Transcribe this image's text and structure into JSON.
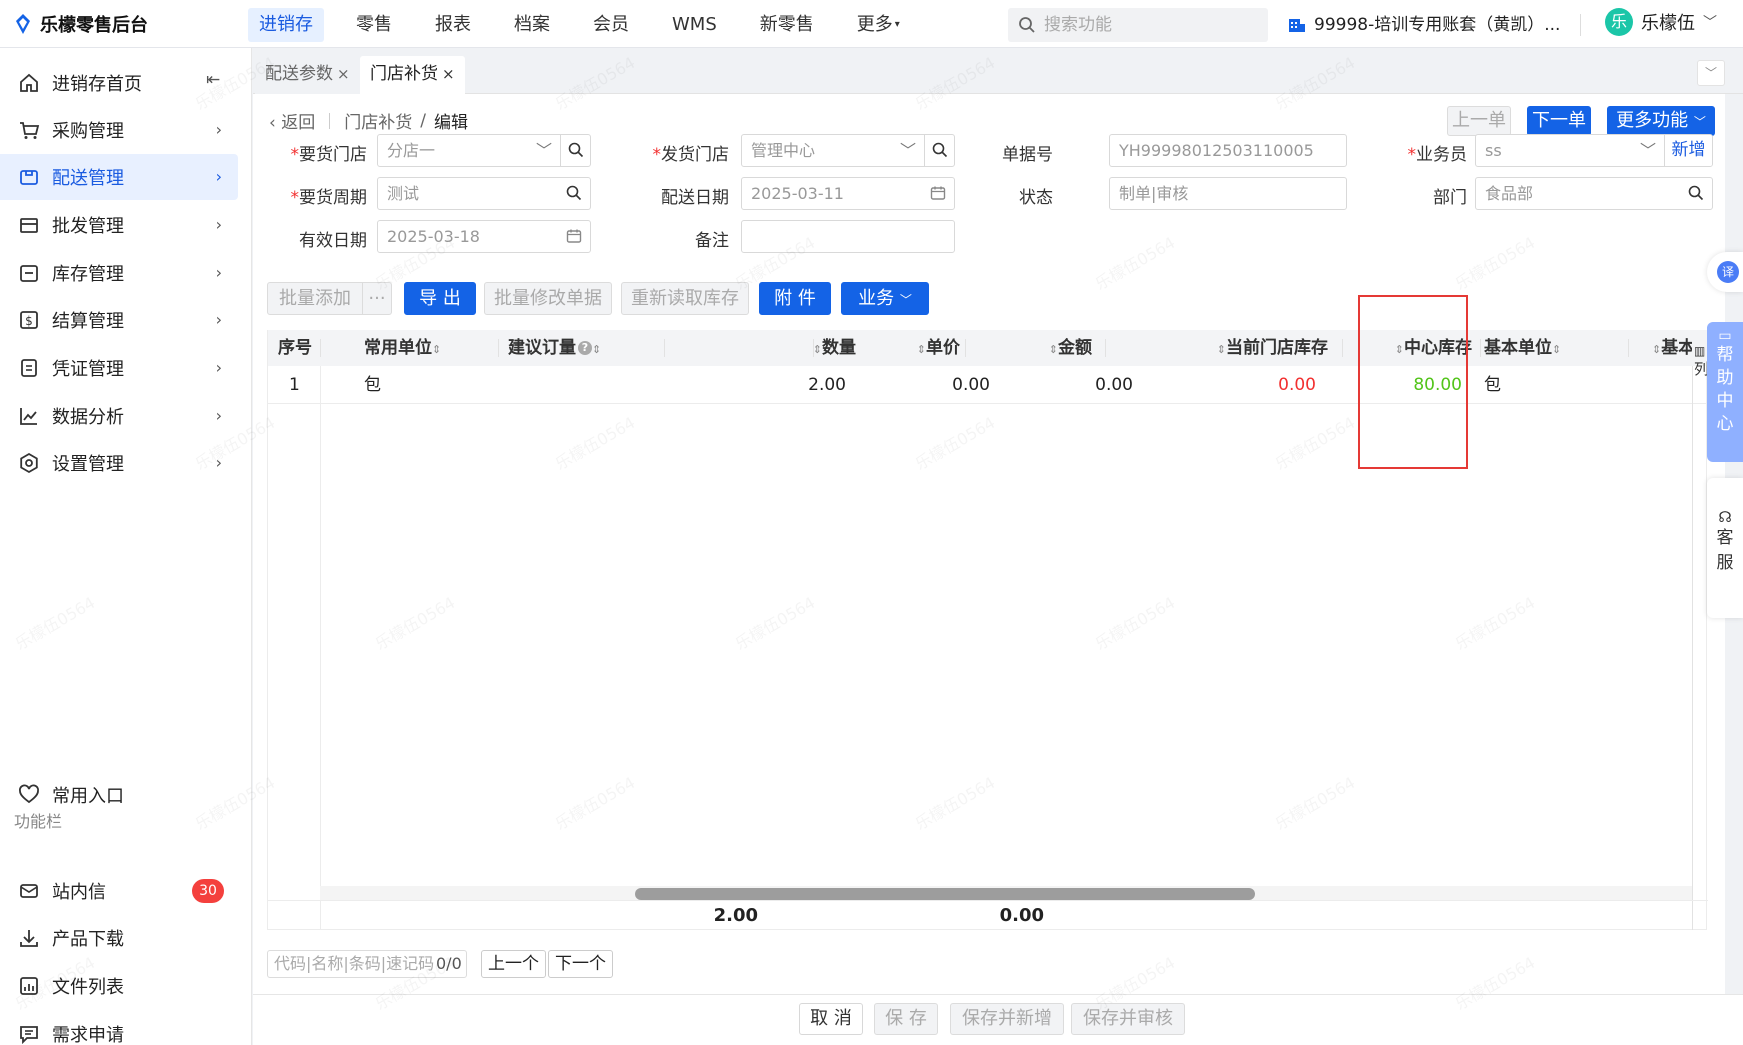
{
  "app": {
    "title": "乐檬零售后台"
  },
  "topnav": [
    "进销存",
    "零售",
    "报表",
    "档案",
    "会员",
    "WMS",
    "新零售",
    "更多"
  ],
  "search": {
    "placeholder": "搜索功能"
  },
  "account": {
    "label": "99998-培训专用账套（黄凯）..."
  },
  "user": {
    "avatar": "乐",
    "name": "乐檬伍"
  },
  "sidebar": {
    "items": [
      "进销存首页",
      "采购管理",
      "配送管理",
      "批发管理",
      "库存管理",
      "结算管理",
      "凭证管理",
      "数据分析",
      "设置管理"
    ],
    "favorites": "常用入口",
    "group_label": "功能栏",
    "bottom": [
      "站内信",
      "产品下载",
      "文件列表",
      "需求申请"
    ],
    "message_badge": "30"
  },
  "tabs": [
    {
      "label": "配送参数"
    },
    {
      "label": "门店补货"
    }
  ],
  "breadcrumb": {
    "back": "返回",
    "parent": "门店补货",
    "sep": "/",
    "current": "编辑"
  },
  "header_buttons": {
    "prev": "上一单",
    "next": "下一单",
    "more": "更多功能"
  },
  "form": {
    "req_store_label": "要货门店",
    "req_store_value": "分店一",
    "ship_store_label": "发货门店",
    "ship_store_value": "管理中心",
    "doc_no_label": "单据号",
    "doc_no_value": "YH99998012503110005",
    "salesman_label": "业务员",
    "salesman_value": "ss",
    "add_new": "新增",
    "cycle_label": "要货周期",
    "cycle_value": "测试",
    "ship_date_label": "配送日期",
    "ship_date_value": "2025-03-11",
    "status_label": "状态",
    "status_value": "制单|审核",
    "dept_label": "部门",
    "dept_value": "食品部",
    "valid_date_label": "有效日期",
    "valid_date_value": "2025-03-18",
    "remark_label": "备注",
    "remark_value": ""
  },
  "toolbar": {
    "batch_add": "批量添加",
    "more_dots": "···",
    "export": "导 出",
    "batch_edit": "批量修改单据",
    "reload_stock": "重新读取库存",
    "attach": "附 件",
    "business": "业务"
  },
  "grid": {
    "columns": [
      "序号",
      "常用单位",
      "建议订量",
      "数量",
      "单价",
      "金额",
      "当前门店库存",
      "中心库存",
      "基本单位",
      "基本"
    ],
    "rows": [
      {
        "seq": "1",
        "unit": "包",
        "suggest": "",
        "qty": "2.00",
        "price": "0.00",
        "amount": "0.00",
        "store_stock": "0.00",
        "center_stock": "80.00",
        "base_unit": "包"
      }
    ],
    "footer": {
      "qty_total": "2.00",
      "amount_total": "0.00"
    },
    "column_setting": "列"
  },
  "find": {
    "placeholder": "代码|名称|条码|速记码",
    "count": "0/0",
    "prev": "上一个",
    "next": "下一个"
  },
  "bottom_buttons": {
    "cancel": "取 消",
    "save": "保 存",
    "save_new": "保存并新增",
    "save_audit": "保存并审核"
  },
  "right_tabs": {
    "translate": "译",
    "help": "帮助中心",
    "service": "客服"
  },
  "colors": {
    "accent": "#1463e6",
    "red": "#f23030",
    "green": "#52c41a",
    "highlight_box": "#e53935"
  },
  "watermark": "乐檬伍0564"
}
